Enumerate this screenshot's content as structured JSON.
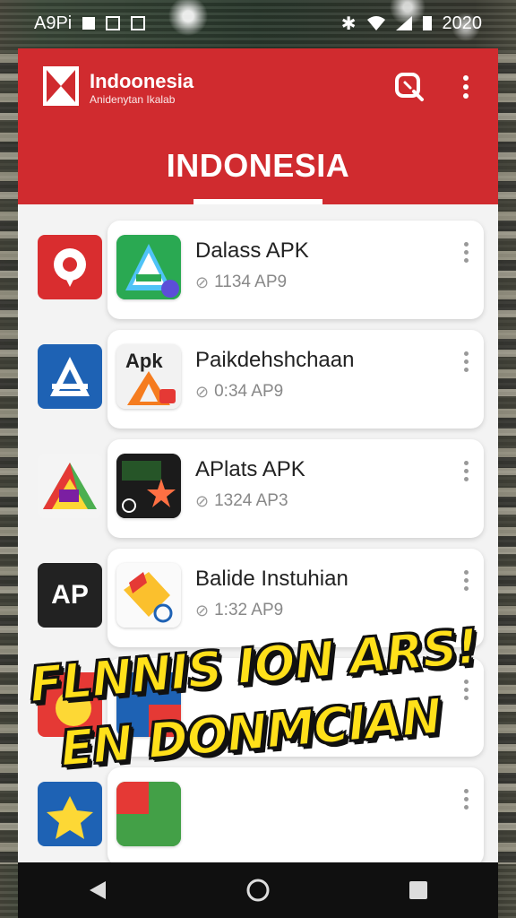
{
  "status_bar": {
    "left_text": "A9Pi",
    "right_text": "2020",
    "icons": [
      "sim-icon",
      "notification-icon",
      "clipboard-icon",
      "bluetooth-icon",
      "wifi-icon",
      "signal-icon",
      "battery-icon"
    ]
  },
  "app_bar": {
    "brand_title": "Indoonesia",
    "brand_subtitle": "Anidenytan Ikalab",
    "page_title": "INDONESIA",
    "accent_color": "#d02b2f",
    "actions": [
      "search-icon",
      "more-vert-icon"
    ]
  },
  "apps": [
    {
      "name": "Dalass APK",
      "meta": "1134 AP9",
      "side_icon": "red-pin-icon",
      "icon": "green-a-icon"
    },
    {
      "name": "Paikdehshchaan",
      "meta": "0:34 AP9",
      "side_icon": "blue-a-icon",
      "icon": "apk-orange-icon",
      "icon_text": "Apk"
    },
    {
      "name": "APlats APK",
      "meta": "1324 AP3",
      "side_icon": "colorful-triangle-icon",
      "icon": "dark-star-icon"
    },
    {
      "name": "Balide Instuhian",
      "meta": "1:32 AP9",
      "side_icon": "ap-badge-icon",
      "side_icon_text": "AP",
      "icon": "yellow-tag-icon"
    },
    {
      "name": "",
      "meta": "",
      "side_icon": "red-yellow-icon",
      "icon": "blue-red-icon"
    },
    {
      "name": "",
      "meta": "",
      "side_icon": "blue-yellow-icon",
      "icon": "mixed-icon"
    }
  ],
  "caption": {
    "line1": "FLNNIS ION ARS!",
    "line2": "EN DONMCIAN",
    "color": "#ffe01a"
  },
  "nav": [
    "back-icon",
    "home-icon",
    "recents-icon"
  ]
}
